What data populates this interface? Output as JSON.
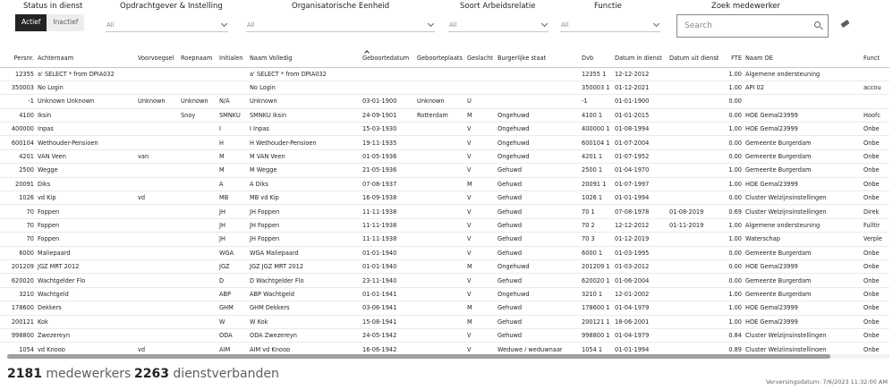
{
  "filters": {
    "status": {
      "label": "Status in dienst",
      "on": "Actief",
      "off": "Inactief"
    },
    "opdrachtgever": {
      "label": "Opdrachtgever & Instelling",
      "value": "All"
    },
    "eenheid": {
      "label": "Organisatorische Eenheid",
      "value": "All"
    },
    "arbeidsrelatie": {
      "label": "Soort Arbeidsrelatie",
      "value": "All"
    },
    "functie": {
      "label": "Functie",
      "value": "All"
    },
    "zoek": {
      "label": "Zoek medewerker",
      "placeholder": "Search"
    }
  },
  "table": {
    "headers": [
      "Persnr.",
      "Achternaam",
      "Voorvoegsel",
      "Roepnaam",
      "Initialen",
      "Naam Volledig",
      "Geboortedatum",
      "Geboorteplaats",
      "Geslacht",
      "Burgerlijke staat",
      "Dvb",
      "Datum in dienst",
      "Datum uit dienst",
      "FTE",
      "Naam OE",
      "Funct"
    ],
    "rows": [
      [
        "12355",
        "a' SELECT * from DPIA032",
        "",
        "",
        "",
        "a' SELECT * from DPIA032",
        "",
        "",
        "",
        "",
        "12355 1",
        "12-12-2012",
        "",
        "1.00",
        "Algemene ondersteuning",
        ""
      ],
      [
        "350003",
        "No Login",
        "",
        "",
        "",
        "No Login",
        "",
        "",
        "",
        "",
        "350003 1",
        "01-12-2021",
        "",
        "1.00",
        "API 02",
        "accou"
      ],
      [
        "-1",
        "Unknown Unknown",
        "Unknown",
        "Unknown",
        "N/A",
        "Unknown",
        "03-01-1900",
        "Unknown",
        "U",
        "",
        "-1",
        "01-01-1900",
        "",
        "0.00",
        "",
        ""
      ],
      [
        "4100",
        "Iksin",
        "",
        "Snoy",
        "SMNKU",
        "SMNKU Iksin",
        "24-09-1901",
        "Rotterdam",
        "M",
        "Ongehuwd",
        "4100 1",
        "01-01-2015",
        "",
        "0.00",
        "HOE Gemal23999",
        "Hoofc"
      ],
      [
        "400000",
        "Inpas",
        "",
        "",
        "I",
        "I Inpas",
        "15-03-1930",
        "",
        "V",
        "Ongehuwd",
        "400000 1",
        "01-08-1994",
        "",
        "1.00",
        "HOE Gemal23999",
        "Onbe"
      ],
      [
        "600104",
        "Wethouder-Pensioen",
        "",
        "",
        "H",
        "H Wethouder-Pensioen",
        "19-11-1935",
        "",
        "V",
        "Ongehuwd",
        "600104 1",
        "01-07-2004",
        "",
        "0.00",
        "Gemeente Burgerdam",
        "Onbe"
      ],
      [
        "4201",
        "VAN Veen",
        "van",
        "",
        "M",
        "M VAN Veen",
        "01-05-1936",
        "",
        "V",
        "Ongehuwd",
        "4201 1",
        "01-07-1952",
        "",
        "0.00",
        "Gemeente Burgerdam",
        "Onbe"
      ],
      [
        "2500",
        "Wegge",
        "",
        "",
        "M",
        "M Wegge",
        "21-05-1936",
        "",
        "V",
        "Gehuwd",
        "2500 1",
        "01-04-1970",
        "",
        "1.00",
        "Gemeente Burgerdam",
        "Onbe"
      ],
      [
        "20091",
        "Diks",
        "",
        "",
        "A",
        "A Diks",
        "07-08-1937",
        "",
        "M",
        "Gehuwd",
        "20091 1",
        "01-07-1997",
        "",
        "1.00",
        "HOE Gemal23999",
        "Onbe"
      ],
      [
        "1026",
        "vd Kip",
        "vd",
        "",
        "MB",
        "MB vd Kip",
        "16-09-1938",
        "",
        "V",
        "Gehuwd",
        "1026 1",
        "01-01-1994",
        "",
        "0.00",
        "Cluster Welzijnsinstellingen",
        "Onbe"
      ],
      [
        "70",
        "Foppen",
        "",
        "",
        "JH",
        "JH Foppen",
        "11-11-1938",
        "",
        "V",
        "Gehuwd",
        "70 1",
        "07-08-1978",
        "01-08-2019",
        "0.69",
        "Cluster Welzijnsinstellingen",
        "Direk"
      ],
      [
        "70",
        "Foppen",
        "",
        "",
        "JH",
        "JH Foppen",
        "11-11-1938",
        "",
        "V",
        "Gehuwd",
        "70 2",
        "12-12-2012",
        "01-11-2019",
        "1.00",
        "Algemene ondersteuning",
        "Fulltir"
      ],
      [
        "70",
        "Foppen",
        "",
        "",
        "JH",
        "JH Foppen",
        "11-11-1938",
        "",
        "V",
        "Gehuwd",
        "70 3",
        "01-12-2019",
        "",
        "1.00",
        "Waterschap",
        "Verple"
      ],
      [
        "6000",
        "Maliepaard",
        "",
        "",
        "WGA",
        "WGA Maliepaard",
        "01-01-1940",
        "",
        "V",
        "Gehuwd",
        "6000 1",
        "01-03-1995",
        "",
        "0.00",
        "Gemeente Burgerdam",
        "Onbe"
      ],
      [
        "201209",
        "JGZ MRT 2012",
        "",
        "",
        "JGZ",
        "JGZ JGZ MRT 2012",
        "01-01-1940",
        "",
        "M",
        "Ongehuwd",
        "201209 1",
        "01-03-2012",
        "",
        "0.00",
        "HOE Gemal23999",
        "Onbe"
      ],
      [
        "620020",
        "Wachtgelder Flo",
        "",
        "",
        "D",
        "D Wachtgelder Flo",
        "23-11-1940",
        "",
        "V",
        "Gehuwd",
        "620020 1",
        "01-06-2004",
        "",
        "0.00",
        "Gemeente Burgerdam",
        "Onbe"
      ],
      [
        "3210",
        "Wachtgeld",
        "",
        "",
        "ABP",
        "ABP Wachtgeld",
        "01-01-1941",
        "",
        "V",
        "Ongehuwd",
        "3210 1",
        "12-01-2002",
        "",
        "1.00",
        "Gemeente Burgerdam",
        "Onbe"
      ],
      [
        "178600",
        "Dekkers",
        "",
        "",
        "GHM",
        "GHM Dekkers",
        "03-06-1941",
        "",
        "M",
        "Gehuwd",
        "178600 1",
        "01-04-1979",
        "",
        "1.00",
        "HOE Gemal23999",
        "Onbe"
      ],
      [
        "200121",
        "Kok",
        "",
        "",
        "W",
        "W Kok",
        "15-08-1941",
        "",
        "M",
        "Gehuwd",
        "200121 1",
        "18-06-2001",
        "",
        "1.00",
        "HOE Gemal23999",
        "Onbe"
      ],
      [
        "998800",
        "Zwezereyn",
        "",
        "",
        "ODA",
        "ODA Zwezereyn",
        "24-05-1942",
        "",
        "V",
        "Gehuwd",
        "998800 1",
        "01-04-1979",
        "",
        "0.84",
        "Cluster Welzijnsinstellingen",
        "Onbe"
      ],
      [
        "1054",
        "vd Knoop",
        "vd",
        "",
        "AJM",
        "AJM vd Knoop",
        "16-06-1942",
        "",
        "V",
        "Weduwe / weduwnaar",
        "1054 1",
        "01-01-1994",
        "",
        "0.89",
        "Cluster Welzijnsinstellingen",
        "Onbe"
      ]
    ]
  },
  "footer": {
    "medewerkers_count": "2181",
    "medewerkers_label": "medewerkers",
    "dienstverbanden_count": "2263",
    "dienstverbanden_label": "dienstverbanden",
    "versiedatum": "Verversingsdatum: 7/6/2023 11:32:00 AM"
  }
}
